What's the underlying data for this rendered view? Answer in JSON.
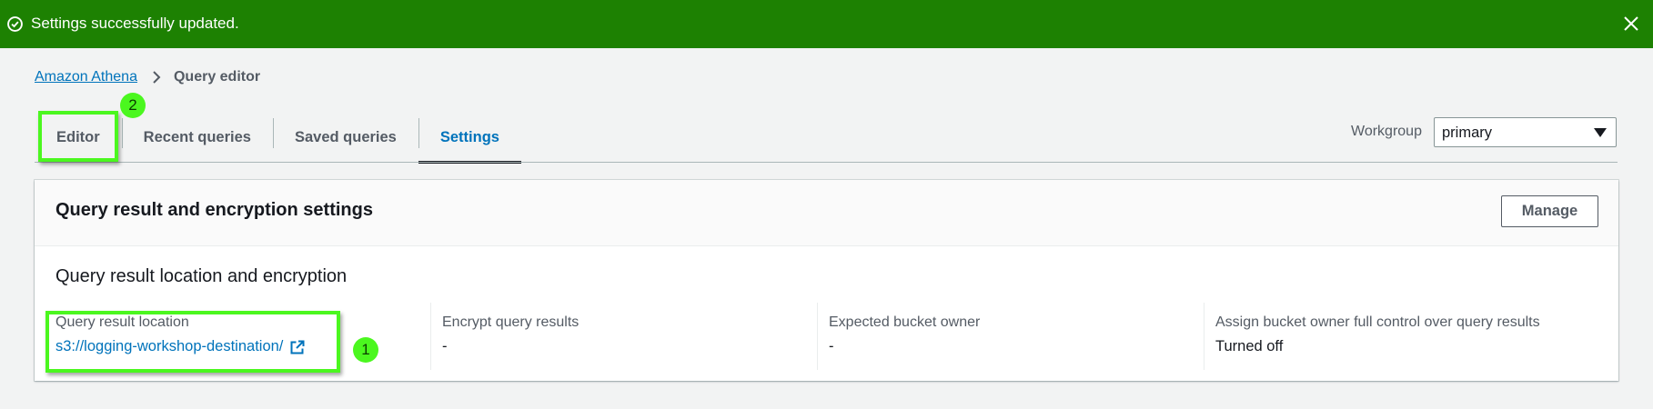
{
  "flash": {
    "message": "Settings successfully updated.",
    "status_color": "#1d8102",
    "icon": "check-circle-icon",
    "close_icon": "close-icon"
  },
  "breadcrumb": {
    "items": [
      "Amazon Athena",
      "Query editor"
    ]
  },
  "tabs": [
    {
      "label": "Editor"
    },
    {
      "label": "Recent queries"
    },
    {
      "label": "Saved queries"
    },
    {
      "label": "Settings",
      "active": true
    }
  ],
  "workgroup": {
    "label": "Workgroup",
    "value": "primary"
  },
  "panel": {
    "title": "Query result and encryption settings",
    "manage_label": "Manage",
    "section_title": "Query result location and encryption",
    "fields": [
      {
        "key": "Query result location",
        "value": "s3://logging-workshop-destination/"
      },
      {
        "key": "Encrypt query results",
        "value": "-"
      },
      {
        "key": "Expected bucket owner",
        "value": "-"
      },
      {
        "key": "Assign bucket owner full control over query results",
        "value": "Turned off"
      }
    ]
  },
  "annotations": {
    "badge_1": "1",
    "badge_2": "2",
    "highlight_color": "#4bf71f"
  },
  "colors": {
    "link": "#0073bb",
    "background": "#f2f3f3"
  }
}
